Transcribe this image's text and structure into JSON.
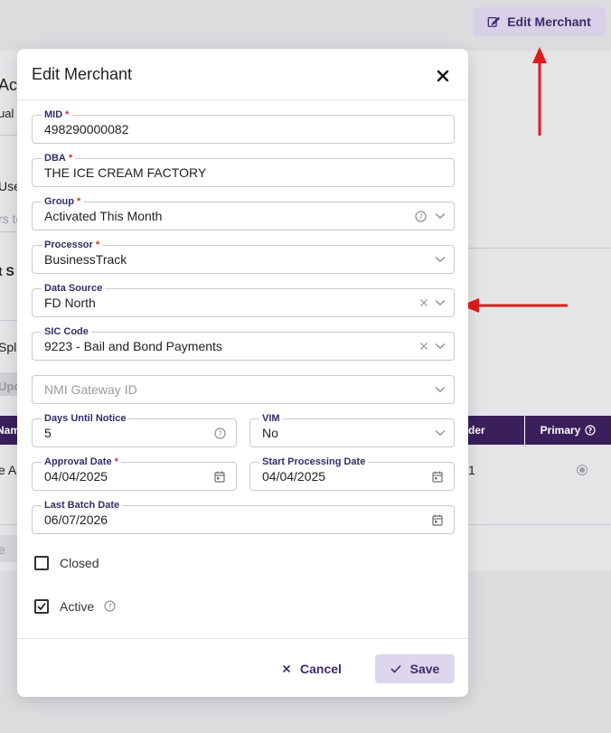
{
  "background": {
    "edit_merchant_button": "Edit Merchant",
    "fragments": [
      "Ac",
      "ual",
      "Use",
      "rs to",
      "t S",
      "Spl",
      "Upd",
      "Nam",
      "e A",
      "e",
      "der",
      "1"
    ],
    "table_primary_header": "Primary"
  },
  "modal": {
    "title": "Edit Merchant",
    "fields": {
      "mid": {
        "label": "MID",
        "value": "498290000082"
      },
      "dba": {
        "label": "DBA",
        "value": "THE ICE CREAM FACTORY"
      },
      "group": {
        "label": "Group",
        "value": "Activated This Month"
      },
      "processor": {
        "label": "Processor",
        "value": "BusinessTrack"
      },
      "data_source": {
        "label": "Data Source",
        "value": "FD North"
      },
      "sic_code": {
        "label": "SIC Code",
        "value": "9223 - Bail and Bond Payments"
      },
      "nmi_gateway": {
        "placeholder": "NMI Gateway ID"
      },
      "days_until_notice": {
        "label": "Days Until Notice",
        "value": "5"
      },
      "vim": {
        "label": "VIM",
        "value": "No"
      },
      "approval_date": {
        "label": "Approval Date",
        "value": "04/04/2025"
      },
      "start_processing_date": {
        "label": "Start Processing Date",
        "value": "04/04/2025"
      },
      "last_batch_date": {
        "label": "Last Batch Date",
        "value": "06/07/2026"
      }
    },
    "required_marker": "*",
    "checkboxes": {
      "closed": {
        "label": "Closed",
        "checked": false
      },
      "active": {
        "label": "Active",
        "checked": true
      }
    },
    "buttons": {
      "cancel": "Cancel",
      "save": "Save"
    }
  },
  "colors": {
    "accent": "#3a1f5c",
    "annotation_arrow": "#e01b1b",
    "required": "#d6332e"
  }
}
